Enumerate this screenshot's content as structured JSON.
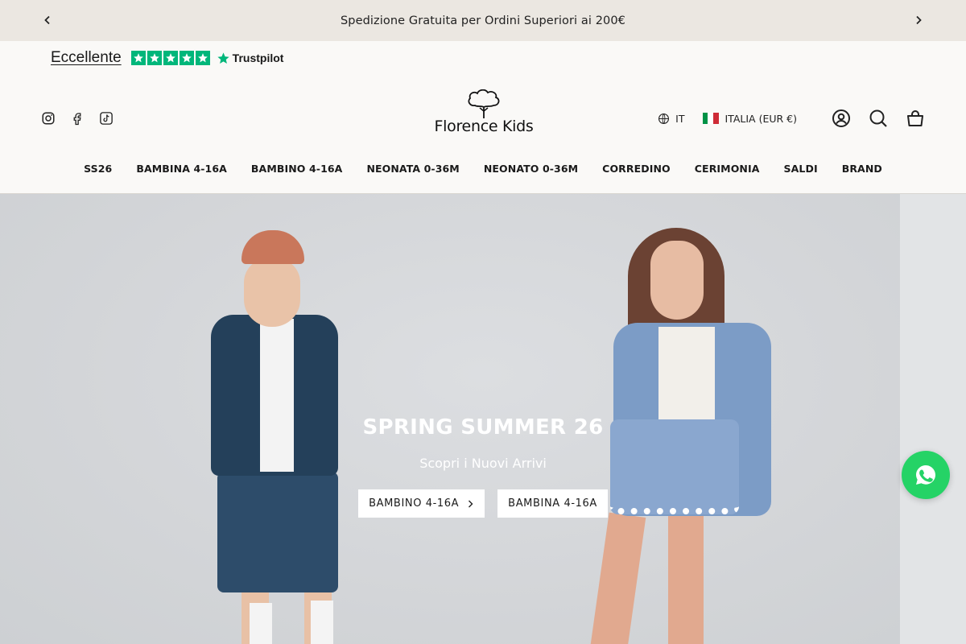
{
  "announcement": {
    "text": "Spedizione Gratuita per Ordini Superiori ai 200€",
    "prev_icon": "chevron-left-icon",
    "next_icon": "chevron-right-icon"
  },
  "trustpilot": {
    "rating_label": "Eccellente",
    "star_count": 5,
    "brand": "Trustpilot",
    "brand_color": "#00b67a"
  },
  "social": {
    "icons": [
      "instagram-icon",
      "facebook-icon",
      "tiktok-icon"
    ]
  },
  "logo": {
    "text": "Florence Kids",
    "icon": "tree-logo-icon"
  },
  "utilities": {
    "language": "IT",
    "language_icon": "globe-icon",
    "country": "ITALIA (EUR €)",
    "flag_colors": [
      "#009246",
      "#ffffff",
      "#ce2b37"
    ],
    "icons": [
      "account-icon",
      "search-icon",
      "cart-icon"
    ]
  },
  "nav": {
    "items": [
      "SS26",
      "BAMBINA 4-16A",
      "BAMBINO 4-16A",
      "NEONATA 0-36M",
      "NEONATO 0-36M",
      "CORREDINO",
      "CERIMONIA",
      "SALDI",
      "BRAND"
    ]
  },
  "hero": {
    "title": "SPRING SUMMER 26",
    "subtitle": "Scopri i Nuovi Arrivi",
    "buttons": [
      {
        "label": "BAMBINO 4-16A",
        "icon": "chevron-right-icon"
      },
      {
        "label": "BAMBINA 4-16A"
      }
    ]
  },
  "whatsapp": {
    "icon": "whatsapp-icon",
    "color": "#25d366"
  }
}
